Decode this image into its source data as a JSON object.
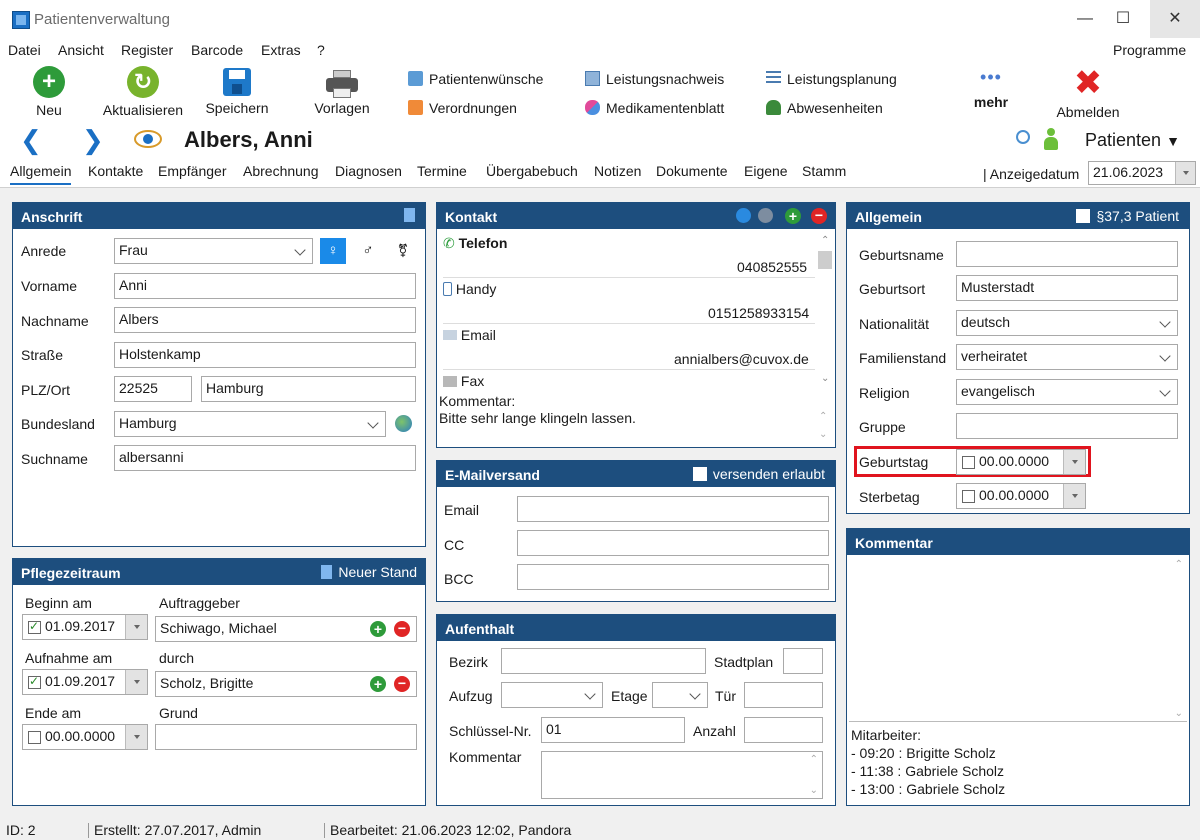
{
  "window": {
    "title": "Patientenverwaltung"
  },
  "menu": [
    "Datei",
    "Ansicht",
    "Register",
    "Barcode",
    "Extras",
    "?"
  ],
  "menu_right": "Programme",
  "toolbar": {
    "neu": "Neu",
    "aktualisieren": "Aktualisieren",
    "speichern": "Speichern",
    "vorlagen": "Vorlagen",
    "patientenwuensche": "Patientenwünsche",
    "verordnungen": "Verordnungen",
    "leistungsnachweis": "Leistungsnachweis",
    "medikamentenblatt": "Medikamentenblatt",
    "leistungsplanung": "Leistungsplanung",
    "abwesenheiten": "Abwesenheiten",
    "mehr": "mehr",
    "abmelden": "Abmelden"
  },
  "patient": {
    "name": "Albers, Anni"
  },
  "nav": {
    "patienten": "Patienten"
  },
  "tabs": [
    "Allgemein",
    "Kontakte",
    "Empfänger",
    "Abrechnung",
    "Diagnosen",
    "Termine",
    "Übergabebuch",
    "Notizen",
    "Dokumente",
    "Eigene",
    "Stamm"
  ],
  "anzeigedatum": {
    "label": "Anzeigedatum",
    "value": "21.06.2023"
  },
  "anschrift": {
    "title": "Anschrift",
    "anrede_label": "Anrede",
    "anrede": "Frau",
    "vorname_label": "Vorname",
    "vorname": "Anni",
    "nachname_label": "Nachname",
    "nachname": "Albers",
    "strasse_label": "Straße",
    "strasse": "Holstenkamp",
    "plzort_label": "PLZ/Ort",
    "plz": "22525",
    "ort": "Hamburg",
    "bundesland_label": "Bundesland",
    "bundesland": "Hamburg",
    "suchname_label": "Suchname",
    "suchname": "albersanni"
  },
  "pflege": {
    "title": "Pflegezeitraum",
    "neuer_stand": "Neuer Stand",
    "beginn_label": "Beginn am",
    "beginn": "01.09.2017",
    "auftraggeber_label": "Auftraggeber",
    "auftraggeber": "Schiwago, Michael",
    "aufnahme_label": "Aufnahme am",
    "aufnahme": "01.09.2017",
    "durch_label": "durch",
    "durch": "Scholz, Brigitte",
    "ende_label": "Ende am",
    "ende": "00.00.0000",
    "grund_label": "Grund",
    "grund": ""
  },
  "kontakt": {
    "title": "Kontakt",
    "telefon_label": "Telefon",
    "telefon": "040852555",
    "handy_label": "Handy",
    "handy": "0151258933154",
    "email_label": "Email",
    "email": "annialbers@cuvox.de",
    "fax_label": "Fax",
    "kommentar_label": "Kommentar:",
    "kommentar": "Bitte sehr lange klingeln lassen."
  },
  "emailversand": {
    "title": "E-Mailversand",
    "versenden": "versenden erlaubt",
    "email_label": "Email",
    "cc_label": "CC",
    "bcc_label": "BCC"
  },
  "aufenthalt": {
    "title": "Aufenthalt",
    "bezirk_label": "Bezirk",
    "stadtplan_label": "Stadtplan",
    "aufzug_label": "Aufzug",
    "etage_label": "Etage",
    "tuer_label": "Tür",
    "schluessel_label": "Schlüssel-Nr.",
    "schluessel": "01",
    "anzahl_label": "Anzahl",
    "kommentar_label": "Kommentar"
  },
  "allgemein": {
    "title": "Allgemein",
    "p37": "§37,3 Patient",
    "geburtsname_label": "Geburtsname",
    "geburtsname": "",
    "geburtsort_label": "Geburtsort",
    "geburtsort": "Musterstadt",
    "nationalitaet_label": "Nationalität",
    "nationalitaet": "deutsch",
    "familienstand_label": "Familienstand",
    "familienstand": "verheiratet",
    "religion_label": "Religion",
    "religion": "evangelisch",
    "gruppe_label": "Gruppe",
    "geburtstag_label": "Geburtstag",
    "geburtstag": "00.00.0000",
    "sterbetag_label": "Sterbetag",
    "sterbetag": "00.00.0000"
  },
  "kommentar": {
    "title": "Kommentar",
    "mitarbeiter_label": "Mitarbeiter:",
    "entries": [
      "- 09:20 : Brigitte Scholz",
      "- 11:38 : Gabriele Scholz",
      "- 13:00 : Gabriele Scholz"
    ]
  },
  "status": {
    "id": "ID: 2",
    "erstellt": "Erstellt: 27.07.2017, Admin",
    "bearbeitet": "Bearbeitet: 21.06.2023 12:02, Pandora"
  },
  "colors": {
    "panel_header": "#1d4e7e",
    "accent": "#1a6fc4",
    "highlight": "#e0141e"
  }
}
